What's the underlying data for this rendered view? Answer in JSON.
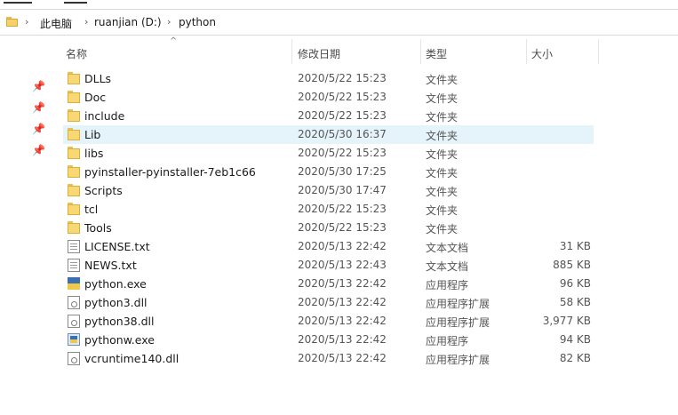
{
  "breadcrumb": {
    "items": [
      "此电脑",
      "ruanjian (D:)",
      "python"
    ]
  },
  "columns": {
    "name": "名称",
    "date": "修改日期",
    "type": "类型",
    "size": "大小"
  },
  "files": [
    {
      "name": "DLLs",
      "date": "2020/5/22 15:23",
      "type": "文件夹",
      "size": "",
      "icon": "folder-icon",
      "selected": false
    },
    {
      "name": "Doc",
      "date": "2020/5/22 15:23",
      "type": "文件夹",
      "size": "",
      "icon": "folder-icon",
      "selected": false
    },
    {
      "name": "include",
      "date": "2020/5/22 15:23",
      "type": "文件夹",
      "size": "",
      "icon": "folder-icon",
      "selected": false
    },
    {
      "name": "Lib",
      "date": "2020/5/30 16:37",
      "type": "文件夹",
      "size": "",
      "icon": "folder-icon",
      "selected": true
    },
    {
      "name": "libs",
      "date": "2020/5/22 15:23",
      "type": "文件夹",
      "size": "",
      "icon": "folder-icon",
      "selected": false
    },
    {
      "name": "pyinstaller-pyinstaller-7eb1c66",
      "date": "2020/5/30 17:25",
      "type": "文件夹",
      "size": "",
      "icon": "folder-icon",
      "selected": false
    },
    {
      "name": "Scripts",
      "date": "2020/5/30 17:47",
      "type": "文件夹",
      "size": "",
      "icon": "folder-icon",
      "selected": false
    },
    {
      "name": "tcl",
      "date": "2020/5/22 15:23",
      "type": "文件夹",
      "size": "",
      "icon": "folder-icon",
      "selected": false
    },
    {
      "name": "Tools",
      "date": "2020/5/22 15:23",
      "type": "文件夹",
      "size": "",
      "icon": "folder-icon",
      "selected": false
    },
    {
      "name": "LICENSE.txt",
      "date": "2020/5/13 22:42",
      "type": "文本文档",
      "size": "31 KB",
      "icon": "text-file-icon",
      "selected": false
    },
    {
      "name": "NEWS.txt",
      "date": "2020/5/13 22:43",
      "type": "文本文档",
      "size": "885 KB",
      "icon": "text-file-icon",
      "selected": false
    },
    {
      "name": "python.exe",
      "date": "2020/5/13 22:42",
      "type": "应用程序",
      "size": "96 KB",
      "icon": "python-exe-icon",
      "selected": false
    },
    {
      "name": "python3.dll",
      "date": "2020/5/13 22:42",
      "type": "应用程序扩展",
      "size": "58 KB",
      "icon": "dll-file-icon",
      "selected": false
    },
    {
      "name": "python38.dll",
      "date": "2020/5/13 22:42",
      "type": "应用程序扩展",
      "size": "3,977 KB",
      "icon": "dll-file-icon",
      "selected": false
    },
    {
      "name": "pythonw.exe",
      "date": "2020/5/13 22:42",
      "type": "应用程序",
      "size": "94 KB",
      "icon": "pythonw-exe-icon",
      "selected": false
    },
    {
      "name": "vcruntime140.dll",
      "date": "2020/5/13 22:42",
      "type": "应用程序扩展",
      "size": "82 KB",
      "icon": "dll-file-icon",
      "selected": false
    }
  ]
}
